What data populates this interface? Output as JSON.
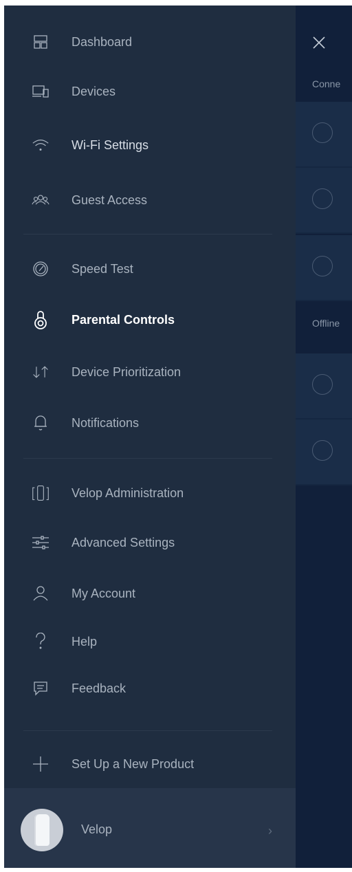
{
  "background": {
    "section_connected": "Conne",
    "section_offline": "Offline",
    "connected_rows": 3,
    "offline_rows": 2
  },
  "menu": {
    "items": [
      {
        "label": "Dashboard",
        "icon": "dashboard-icon"
      },
      {
        "label": "Devices",
        "icon": "devices-icon"
      },
      {
        "label": "Wi-Fi Settings",
        "icon": "wifi-icon"
      },
      {
        "label": "Guest Access",
        "icon": "guest-access-icon"
      },
      {
        "label": "Speed Test",
        "icon": "speedometer-icon"
      },
      {
        "label": "Parental Controls",
        "icon": "lock-icon"
      },
      {
        "label": "Device Prioritization",
        "icon": "priority-arrows-icon"
      },
      {
        "label": "Notifications",
        "icon": "bell-icon"
      },
      {
        "label": "Velop Administration",
        "icon": "velop-nodes-icon"
      },
      {
        "label": "Advanced Settings",
        "icon": "sliders-icon"
      },
      {
        "label": "My Account",
        "icon": "user-icon"
      },
      {
        "label": "Help",
        "icon": "question-icon"
      },
      {
        "label": "Feedback",
        "icon": "feedback-icon"
      },
      {
        "label": "Set Up a New Product",
        "icon": "plus-icon"
      }
    ],
    "active": "Parental Controls"
  },
  "footer": {
    "product_name": "Velop"
  },
  "colors": {
    "drawer_bg": "#1f2d40",
    "page_bg": "#0f1e33",
    "text_muted": "#a9b3bf",
    "text_active": "#ffffff"
  }
}
